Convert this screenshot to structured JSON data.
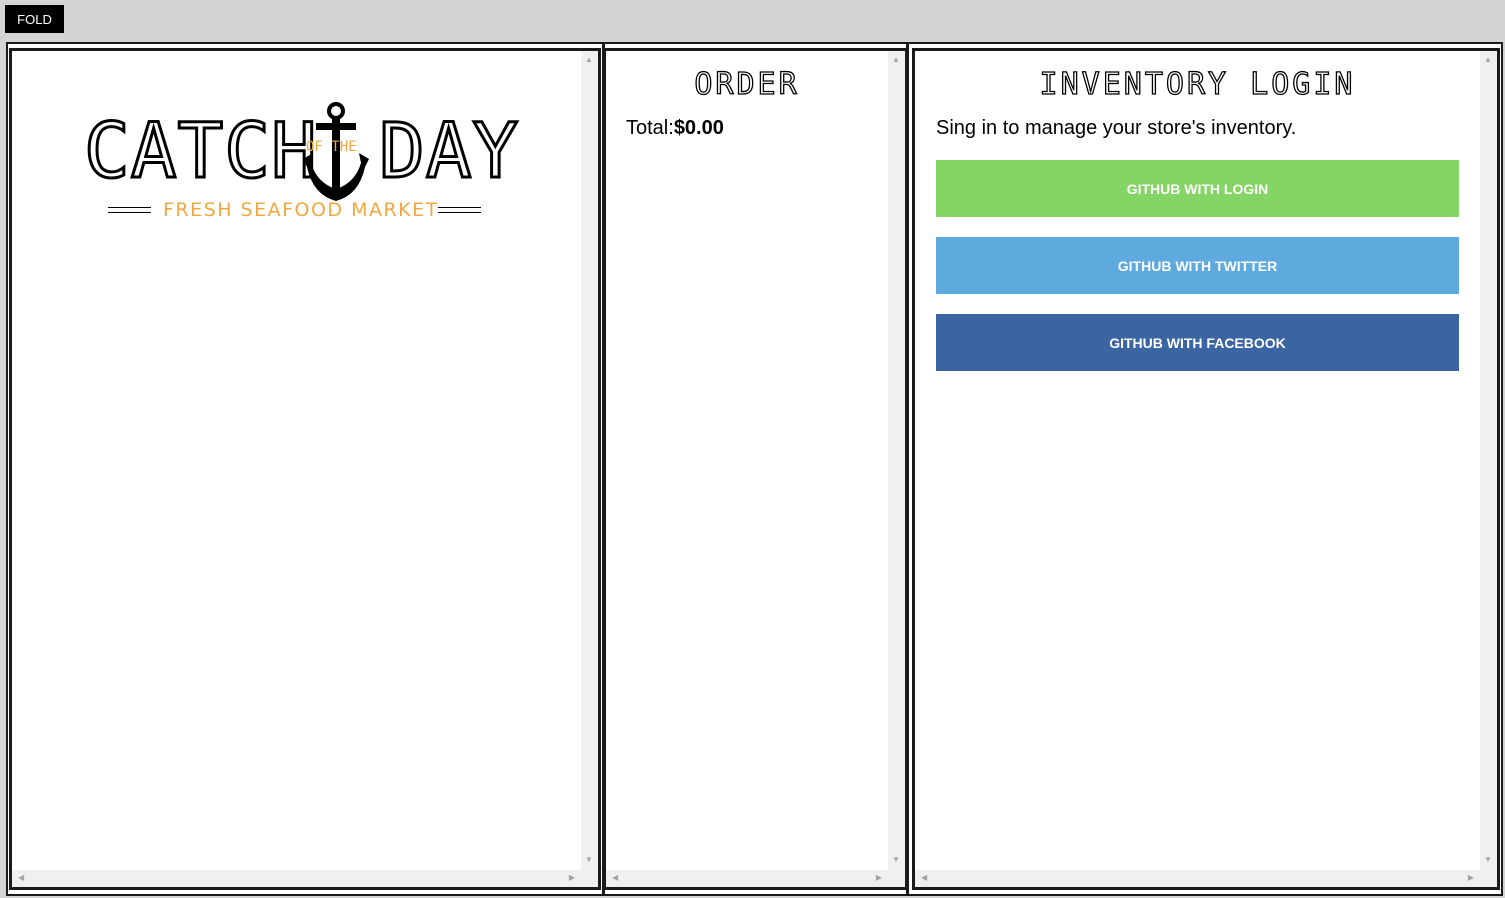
{
  "toolbar": {
    "fold_label": "FOLD"
  },
  "menu": {
    "logo": {
      "word_left": "CATCH",
      "word_middle": "OF THE",
      "word_right": "DAY",
      "tagline": "FRESH SEAFOOD MARKET"
    }
  },
  "order": {
    "title": "ORDER",
    "total_label": "Total:",
    "total_value": "$0.00"
  },
  "inventory": {
    "title": "INVENTORY LOGIN",
    "subtitle": "Sing in to manage your store's inventory.",
    "buttons": [
      {
        "label": "GITHUB WITH LOGIN",
        "color": "#84d466"
      },
      {
        "label": "GITHUB WITH TWITTER",
        "color": "#5ea9dd"
      },
      {
        "label": "GITHUB WITH FACEBOOK",
        "color": "#3b64a2"
      }
    ]
  }
}
